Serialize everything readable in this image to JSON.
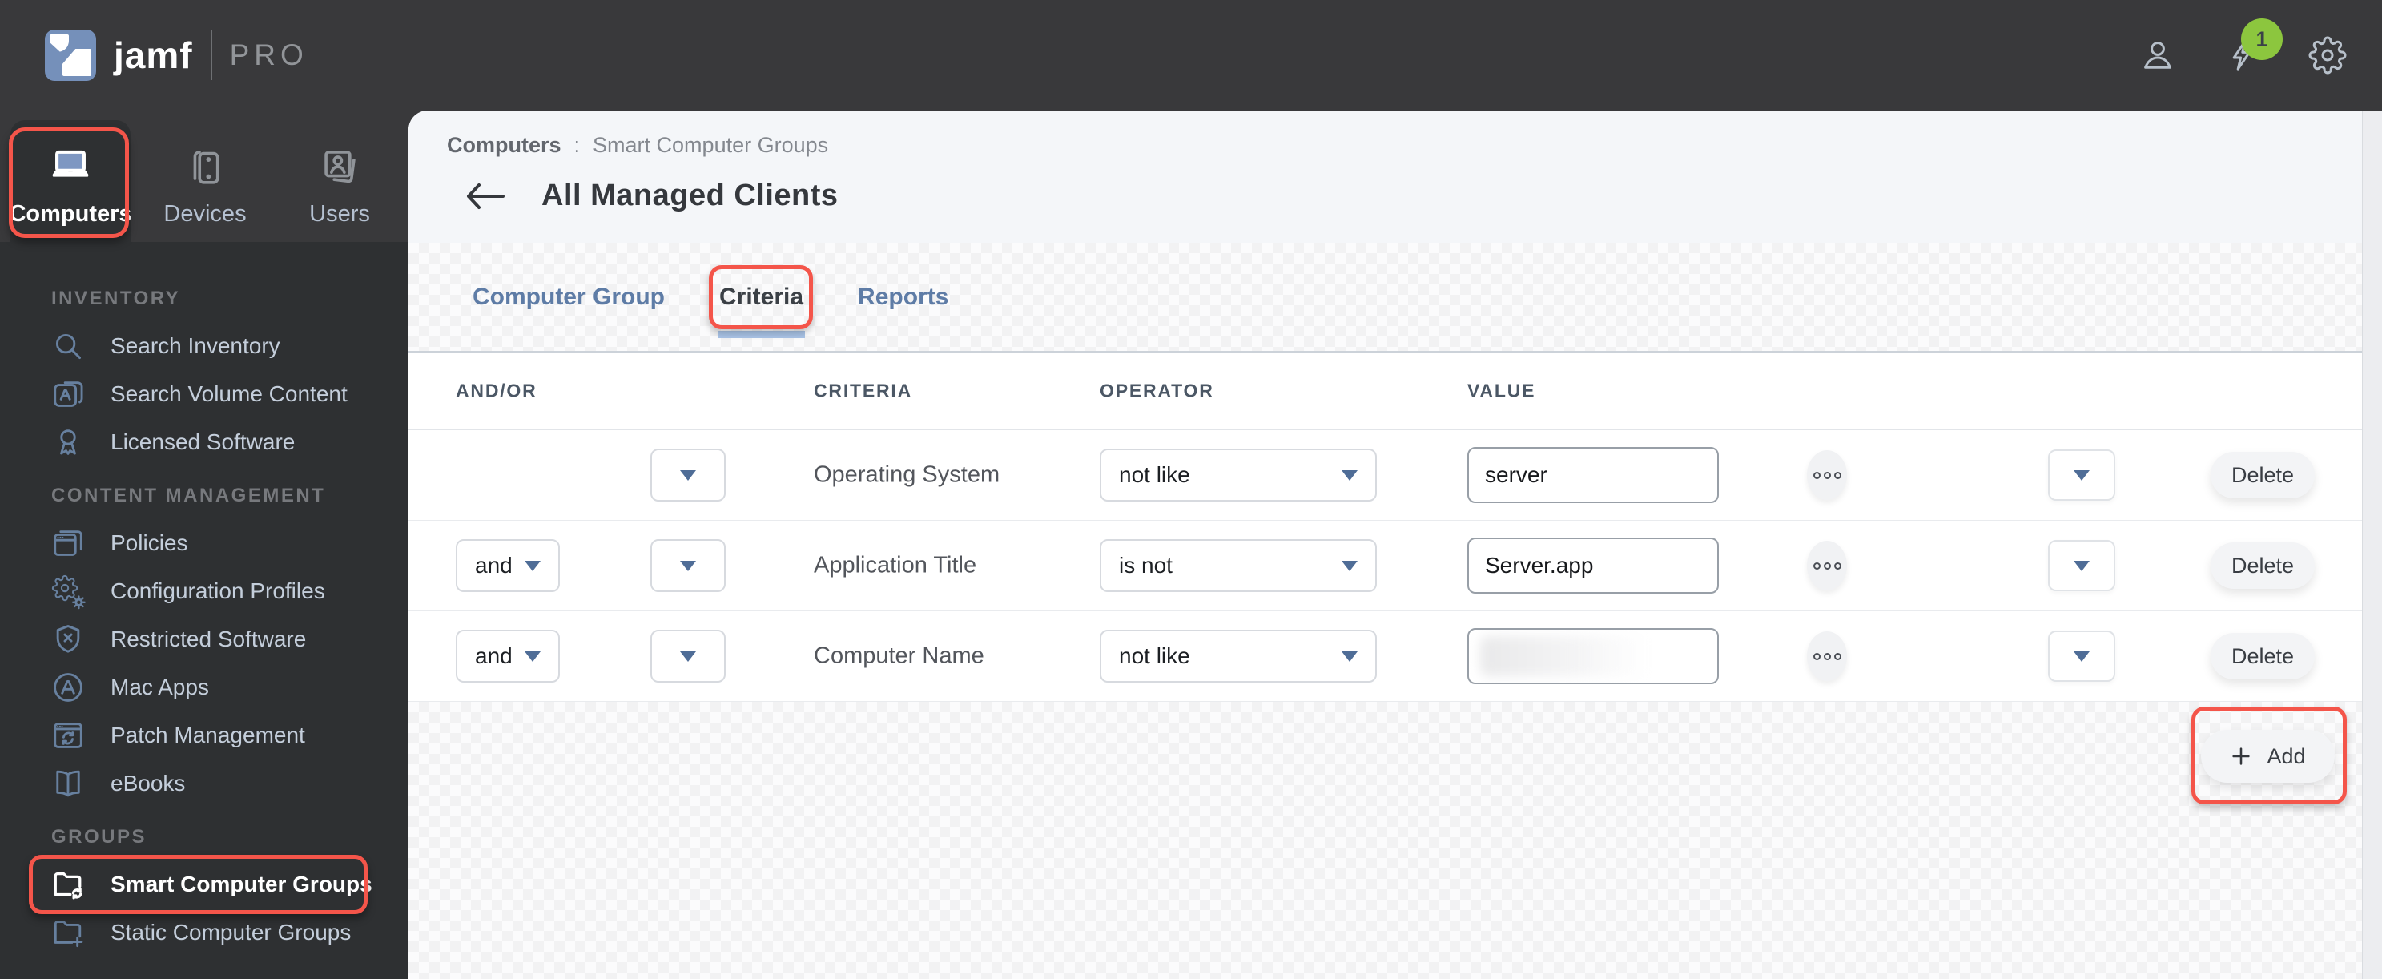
{
  "topbar": {
    "logo_primary": "jamf",
    "logo_secondary": "PRO",
    "notification_count": "1",
    "badge_color": "#8cc63e",
    "icons": [
      "user-icon",
      "lightning-icon",
      "gear-icon"
    ]
  },
  "sidebar": {
    "context_tabs": [
      {
        "label": "Computers",
        "icon": "laptop",
        "active": true,
        "annotated": true
      },
      {
        "label": "Devices",
        "icon": "mobile-devices",
        "active": false
      },
      {
        "label": "Users",
        "icon": "user-cards",
        "active": false
      }
    ],
    "sections": [
      {
        "title": "INVENTORY",
        "items": [
          {
            "label": "Search Inventory",
            "icon": "search"
          },
          {
            "label": "Search Volume Content",
            "icon": "app-pages"
          },
          {
            "label": "Licensed Software",
            "icon": "award-ribbon"
          }
        ]
      },
      {
        "title": "CONTENT MANAGEMENT",
        "items": [
          {
            "label": "Policies",
            "icon": "browser-windows"
          },
          {
            "label": "Configuration Profiles",
            "icon": "gears"
          },
          {
            "label": "Restricted Software",
            "icon": "shield-x"
          },
          {
            "label": "Mac Apps",
            "icon": "app-store-circle"
          },
          {
            "label": "Patch Management",
            "icon": "browser-refresh"
          },
          {
            "label": "eBooks",
            "icon": "open-book"
          }
        ]
      },
      {
        "title": "GROUPS",
        "items": [
          {
            "label": "Smart Computer Groups",
            "icon": "folder-sync",
            "active": true,
            "annotated": true
          },
          {
            "label": "Static Computer Groups",
            "icon": "folder-plus"
          }
        ]
      }
    ]
  },
  "main": {
    "breadcrumb": {
      "parent": "Computers",
      "separator": ":",
      "current": "Smart Computer Groups"
    },
    "page_title": "All Managed Clients",
    "tabs": [
      {
        "label": "Computer Group",
        "active": false
      },
      {
        "label": "Criteria",
        "active": true,
        "annotated": true
      },
      {
        "label": "Reports",
        "active": false
      }
    ],
    "criteria_table": {
      "columns": [
        "AND/OR",
        "CRITERIA",
        "OPERATOR",
        "VALUE"
      ],
      "rows": [
        {
          "and_or": "",
          "criteria": "Operating System",
          "operator": "not like",
          "value": "server",
          "value_redacted": false
        },
        {
          "and_or": "and",
          "criteria": "Application Title",
          "operator": "is not",
          "value": "Server.app",
          "value_redacted": false
        },
        {
          "and_or": "and",
          "criteria": "Computer Name",
          "operator": "not like",
          "value": "",
          "value_redacted": true
        }
      ],
      "row_actions": {
        "delete_label": "Delete"
      },
      "add_button_label": "Add"
    },
    "annotation_color": "#f4554a"
  }
}
